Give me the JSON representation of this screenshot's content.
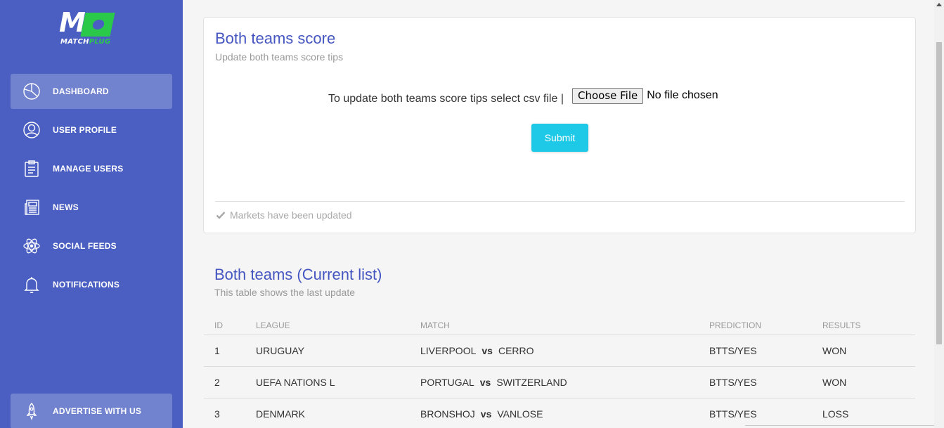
{
  "brand": {
    "logo_letter": "M",
    "logo_text_white": "MATCH",
    "logo_text_green": "PLUG",
    "green": "#2bc94a",
    "sidebar_color": "#4a5fc1",
    "accent": "#4556c1",
    "button_color": "#1ec8e7"
  },
  "sidebar": {
    "items": [
      {
        "label": "DASHBOARD",
        "icon": "pie-chart-icon",
        "active": true
      },
      {
        "label": "USER PROFILE",
        "icon": "user-icon",
        "active": false
      },
      {
        "label": "MANAGE USERS",
        "icon": "clipboard-icon",
        "active": false
      },
      {
        "label": "NEWS",
        "icon": "newspaper-icon",
        "active": false
      },
      {
        "label": "SOCIAL FEEDS",
        "icon": "atom-icon",
        "active": false
      },
      {
        "label": "NOTIFICATIONS",
        "icon": "bell-icon",
        "active": false
      }
    ],
    "bottom_item": {
      "label": "ADVERTISE WITH US",
      "icon": "rocket-icon"
    }
  },
  "upload_card": {
    "title": "Both teams score",
    "subtitle": "Update both teams score tips",
    "upload_label": "To update both teams score tips select csv file |",
    "file_button": "Choose File",
    "file_status": "No file chosen",
    "submit": "Submit",
    "footer": "Markets have been updated"
  },
  "list": {
    "title": "Both teams (Current list)",
    "subtitle": "This table shows the last update",
    "columns": [
      "ID",
      "LEAGUE",
      "MATCH",
      "PREDICTION",
      "RESULTS"
    ],
    "vs_label": "vs",
    "rows": [
      {
        "id": "1",
        "league": "URUGUAY",
        "home": "LIVERPOOL",
        "away": "CERRO",
        "prediction": "BTTS/YES",
        "result": "WON"
      },
      {
        "id": "2",
        "league": "UEFA NATIONS L",
        "home": "PORTUGAL",
        "away": "SWITZERLAND",
        "prediction": "BTTS/YES",
        "result": "WON"
      },
      {
        "id": "3",
        "league": "DENMARK",
        "home": "BRONSHOJ",
        "away": "VANLOSE",
        "prediction": "BTTS/YES",
        "result": "LOSS"
      }
    ]
  }
}
